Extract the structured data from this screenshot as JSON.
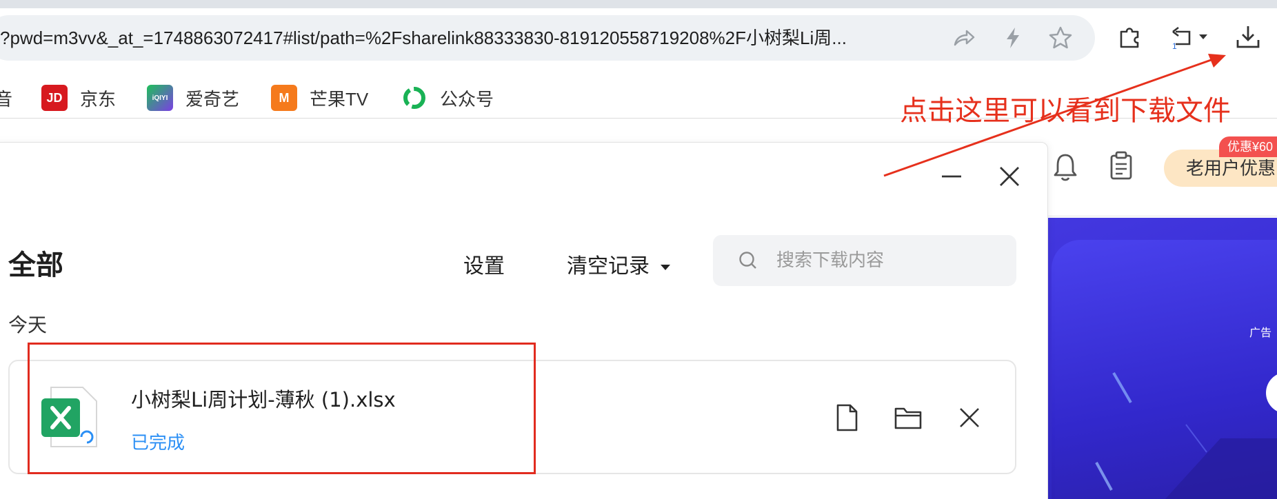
{
  "browser": {
    "address_url": "?pwd=m3vv&_at_=1748863072417#list/path=%2Fsharelink88333830-819120558719208%2F小树梨Li周...",
    "address_icons": [
      "share-icon",
      "lightning-icon",
      "star-icon"
    ],
    "toolbar_icons": [
      "extensions-icon",
      "undo-history-icon",
      "download-icon"
    ],
    "undo_badge": "1",
    "bookmarks": [
      {
        "label": "音",
        "icon": "music-icon"
      },
      {
        "label": "京东",
        "icon": "jd-logo",
        "logo_text": "JD",
        "color": "#d7191f"
      },
      {
        "label": "爱奇艺",
        "icon": "iqiyi-logo",
        "logo_text": "iQIYI",
        "color": "#1ec05a"
      },
      {
        "label": "芒果TV",
        "icon": "mgtv-logo",
        "logo_text": "M",
        "color": "#f57a1c"
      },
      {
        "label": "公众号",
        "icon": "wechat-official-logo",
        "color": "#19b255"
      }
    ]
  },
  "annotation": {
    "text": "点击这里可以看到下载文件",
    "color": "#e6301c"
  },
  "page": {
    "user_pill": "老用户优惠",
    "promo_badge": "优惠¥60",
    "ad_label": "广告",
    "banner_color": "#3a2fd6"
  },
  "download_panel": {
    "title": "全部",
    "settings_label": "设置",
    "clear_label": "清空记录",
    "search_placeholder": "搜索下载内容",
    "section_label": "今天",
    "items": [
      {
        "file_name": "小树梨Li周计划-薄秋 (1).xlsx",
        "status": "已完成",
        "file_type": "xlsx",
        "actions": [
          "open-file-icon",
          "open-folder-icon",
          "remove-icon"
        ]
      }
    ]
  }
}
